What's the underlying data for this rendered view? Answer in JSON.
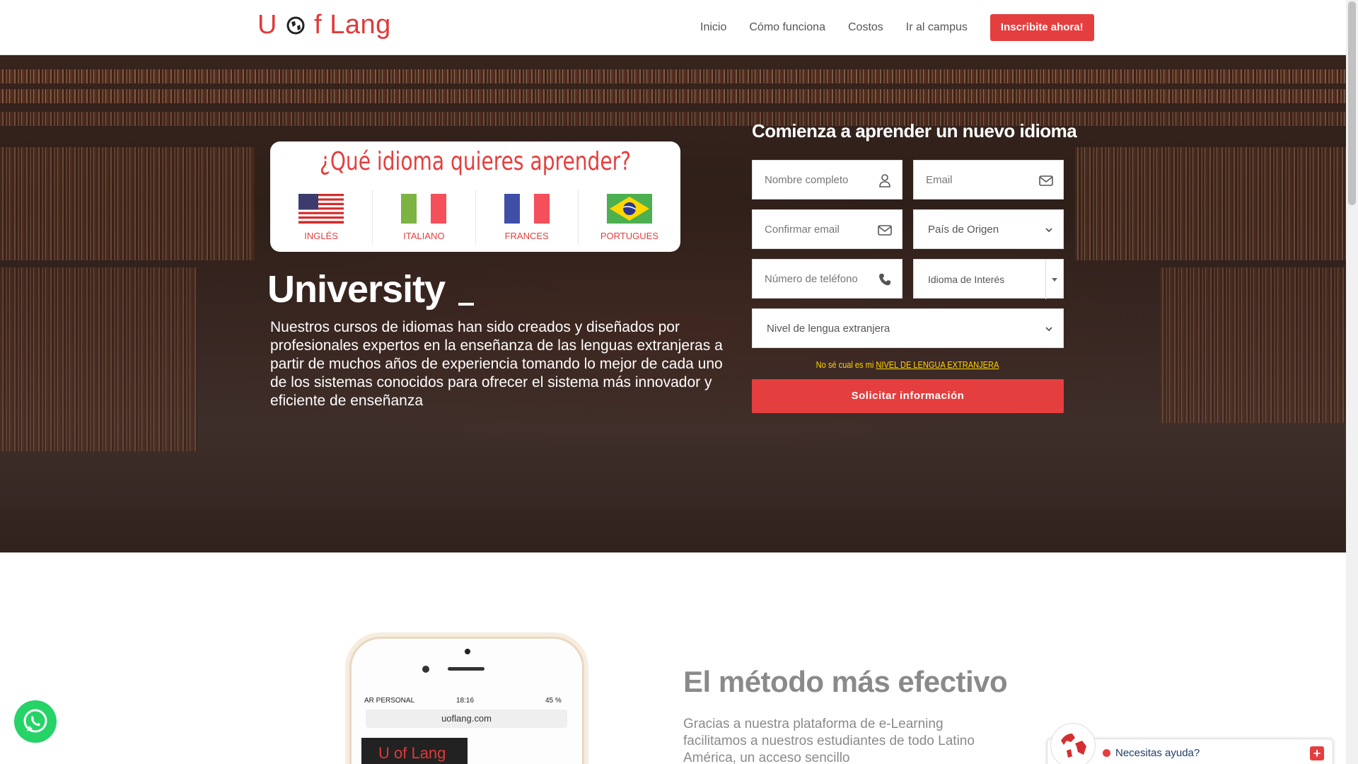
{
  "header": {
    "logo_text_left": "U",
    "logo_text_right": "f Lang",
    "nav": [
      "Inicio",
      "Cómo funciona",
      "Costos",
      "Ir al campus"
    ],
    "cta": "Inscribite ahora!"
  },
  "hero": {
    "question": "¿Qué idioma quieres aprender?",
    "languages": [
      "INGLÉS",
      "ITALIANO",
      "FRANCES",
      "PORTUGUES"
    ],
    "headline": "University",
    "description": "Nuestros cursos de idiomas han sido creados y diseñados por profesionales expertos en la enseñanza de las lenguas extranjeras a partir de muchos años de experiencia tomando lo mejor de cada uno de los sistemas conocidos para ofrecer el sistema más innovador y eficiente de enseñanza"
  },
  "form": {
    "title": "Comienza a aprender un nuevo idioma",
    "full_name": "Nombre completo",
    "email": "Email",
    "confirm_email": "Confirmar email",
    "country": "País de Origen",
    "phone": "Número de teléfono",
    "language_interest": "Idioma de Interés",
    "level": "Nivel de lengua extranjera",
    "help_prefix": "No sé cual es mi",
    "help_link": "NIVEL DE LENGUA EXTRANJERA",
    "submit": "Solicitar información"
  },
  "phone_mock": {
    "carrier": "AR PERSONAL",
    "time": "18:16",
    "battery": "45 %",
    "url": "uoflang.com",
    "app_logo": "U of Lang"
  },
  "method": {
    "title": "El método más efectivo",
    "description": "Gracias a nuestra plataforma de e-Learning facilitamos a nuestros estudiantes de todo Latino América, un acceso sencillo"
  },
  "chat": {
    "label": "Necesitas ayuda?"
  },
  "colors": {
    "brand": "#e53e3e",
    "link_yellow": "#ffd400",
    "whatsapp": "#25d366"
  }
}
